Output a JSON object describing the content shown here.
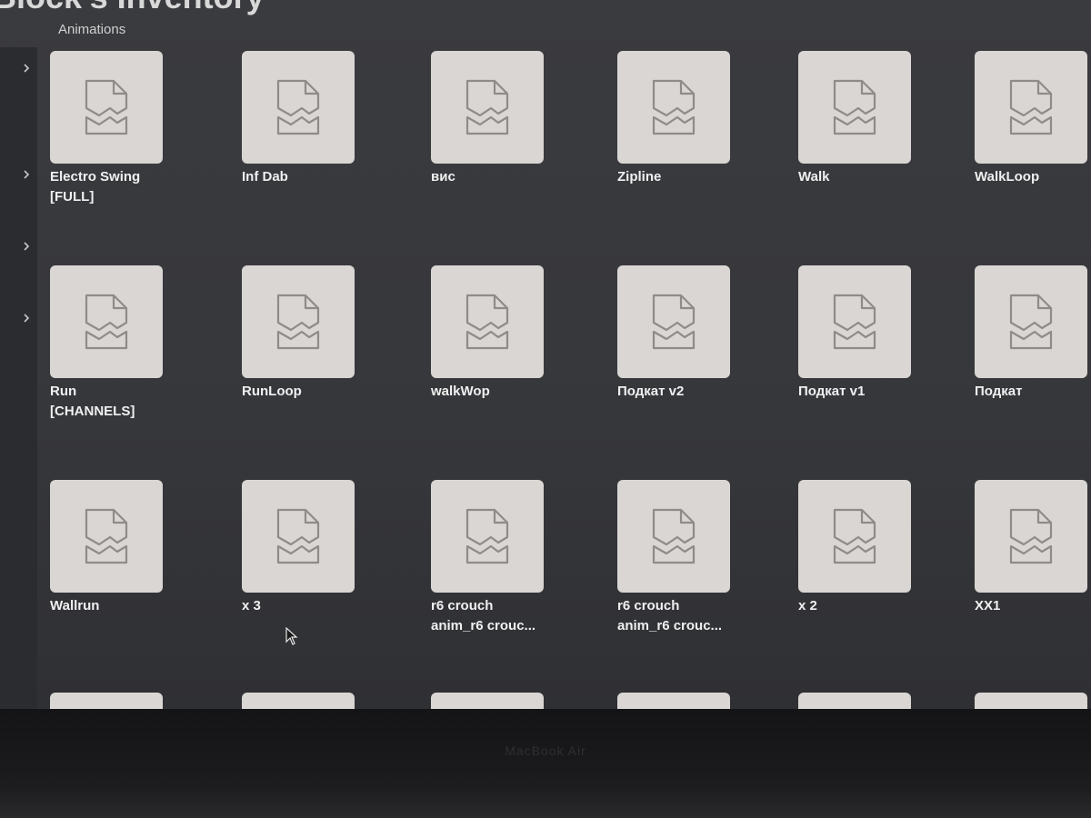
{
  "window": {
    "title": "Block's Inventory",
    "section": "Animations"
  },
  "icons": {
    "sidebar_toggle": "chevron-right-icon",
    "thumbnail": "broken-image-file-icon",
    "pointer": "mouse-cursor-icon"
  },
  "colors": {
    "background": "#38393d",
    "sidebar": "#2b2c30",
    "thumbnail": "#d9d6d3",
    "text": "#f0f0f0"
  },
  "items": [
    {
      "name": "Electro Swing",
      "sub": "[FULL]"
    },
    {
      "name": "Inf Dab",
      "sub": ""
    },
    {
      "name": "вис",
      "sub": ""
    },
    {
      "name": "Zipline",
      "sub": ""
    },
    {
      "name": "Walk",
      "sub": ""
    },
    {
      "name": "WalkLoop",
      "sub": ""
    },
    {
      "name": "Run",
      "sub": "[CHANNELS]"
    },
    {
      "name": "RunLoop",
      "sub": ""
    },
    {
      "name": "walkWop",
      "sub": ""
    },
    {
      "name": "Подкат v2",
      "sub": ""
    },
    {
      "name": "Подкат v1",
      "sub": ""
    },
    {
      "name": "Подкат",
      "sub": ""
    },
    {
      "name": "Wallrun",
      "sub": ""
    },
    {
      "name": "x 3",
      "sub": ""
    },
    {
      "name": "r6 crouch",
      "sub": "anim_r6 crouc..."
    },
    {
      "name": "r6 crouch",
      "sub": "anim_r6 crouc..."
    },
    {
      "name": "x 2",
      "sub": ""
    },
    {
      "name": "XX1",
      "sub": ""
    },
    {
      "name": "",
      "sub": ""
    },
    {
      "name": "",
      "sub": ""
    },
    {
      "name": "",
      "sub": ""
    },
    {
      "name": "",
      "sub": ""
    },
    {
      "name": "",
      "sub": ""
    },
    {
      "name": "",
      "sub": ""
    }
  ],
  "device": {
    "label": "MacBook Air"
  }
}
